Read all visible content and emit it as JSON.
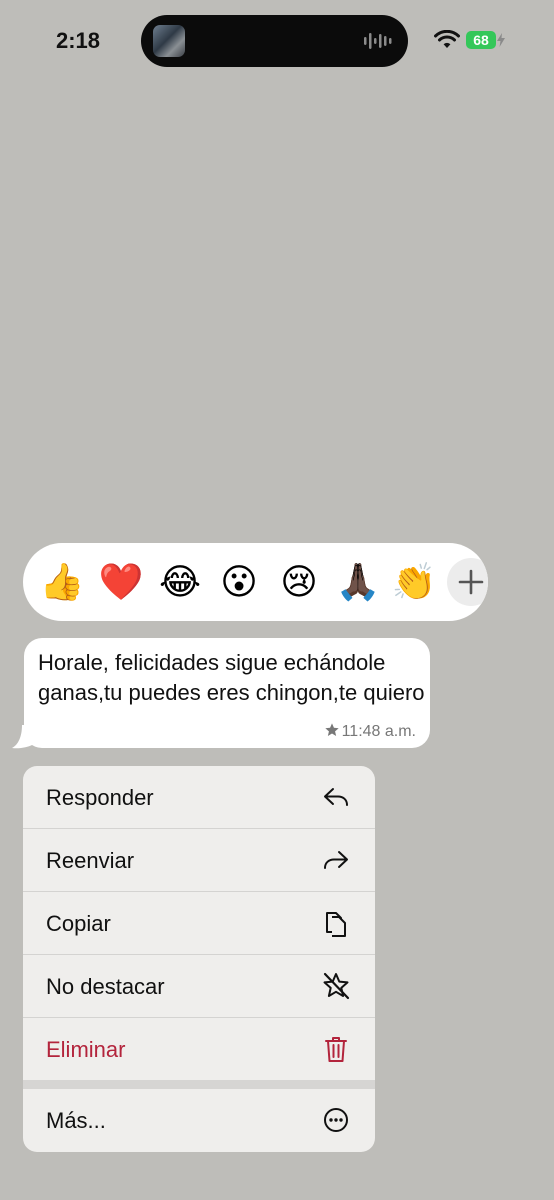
{
  "status_bar": {
    "time": "2:18",
    "battery_level": "68",
    "icons": [
      "wifi-icon",
      "battery-icon",
      "charging-bolt-icon"
    ]
  },
  "reactions": {
    "items": [
      "👍",
      "❤️",
      "😂",
      "😮",
      "😢",
      "🙏🏿",
      "👏"
    ],
    "selected": "❤️",
    "add_icon": "plus-icon"
  },
  "message": {
    "text": "Horale, felicidades sigue echándole ganas,tu puedes eres chingon,te quiero",
    "time": "11:48 a.m.",
    "starred": true
  },
  "menu": {
    "reply": {
      "label": "Responder",
      "icon": "reply-icon"
    },
    "forward": {
      "label": "Reenviar",
      "icon": "forward-icon"
    },
    "copy": {
      "label": "Copiar",
      "icon": "copy-icon"
    },
    "unstar": {
      "label": "No destacar",
      "icon": "unstar-icon"
    },
    "delete": {
      "label": "Eliminar",
      "icon": "trash-icon"
    },
    "more": {
      "label": "Más...",
      "icon": "more-icon"
    }
  },
  "colors": {
    "background": "#bebdb9",
    "destructive": "#b3243c",
    "battery": "#34c759"
  }
}
